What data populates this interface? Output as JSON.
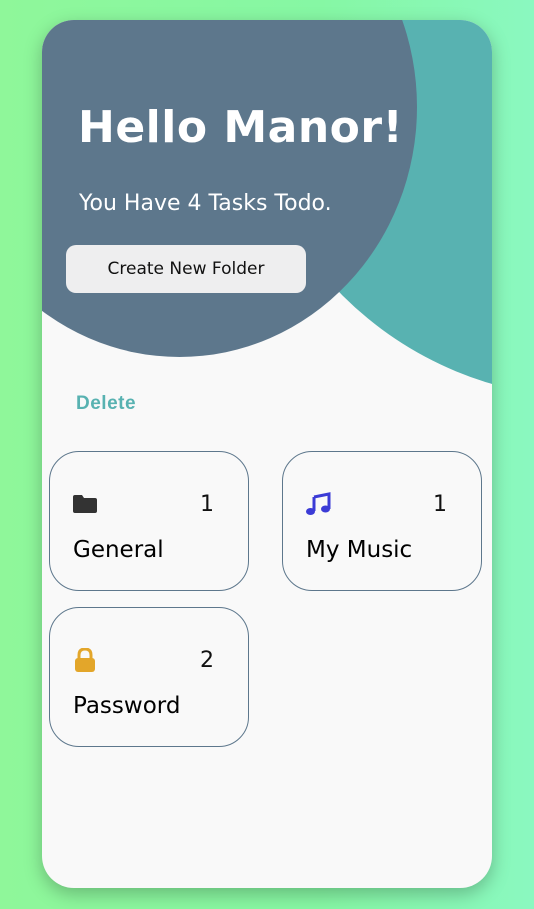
{
  "header": {
    "greeting": "Hello Manor!",
    "task_summary": "You Have 4 Tasks Todo.",
    "create_button_label": "Create New Folder"
  },
  "actions": {
    "delete_label": "Delete"
  },
  "folders": [
    {
      "name": "General",
      "count": "1",
      "icon": "folder-icon",
      "icon_color": "#333333"
    },
    {
      "name": "My Music",
      "count": "1",
      "icon": "music-note-icon",
      "icon_color": "#3b3bd6"
    },
    {
      "name": "Password",
      "count": "2",
      "icon": "lock-icon",
      "icon_color": "#e3a62a"
    }
  ],
  "colors": {
    "accent_teal": "#58b2b1",
    "header_slate": "#5d778c",
    "background_green": "#8ff79a",
    "card_border": "#5d778c"
  }
}
